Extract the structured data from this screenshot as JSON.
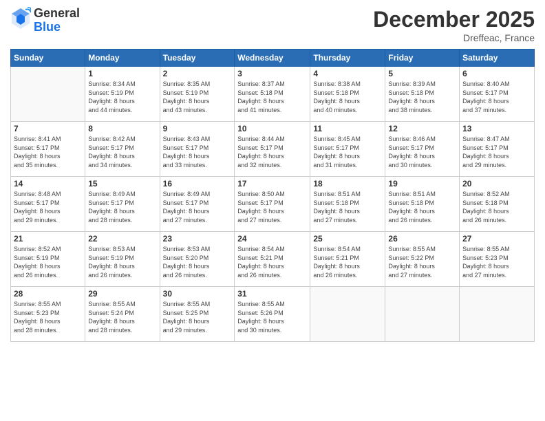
{
  "header": {
    "logo_general": "General",
    "logo_blue": "Blue",
    "month": "December 2025",
    "location": "Dreffeac, France"
  },
  "weekdays": [
    "Sunday",
    "Monday",
    "Tuesday",
    "Wednesday",
    "Thursday",
    "Friday",
    "Saturday"
  ],
  "weeks": [
    [
      {
        "day": "",
        "info": ""
      },
      {
        "day": "1",
        "info": "Sunrise: 8:34 AM\nSunset: 5:19 PM\nDaylight: 8 hours\nand 44 minutes."
      },
      {
        "day": "2",
        "info": "Sunrise: 8:35 AM\nSunset: 5:19 PM\nDaylight: 8 hours\nand 43 minutes."
      },
      {
        "day": "3",
        "info": "Sunrise: 8:37 AM\nSunset: 5:18 PM\nDaylight: 8 hours\nand 41 minutes."
      },
      {
        "day": "4",
        "info": "Sunrise: 8:38 AM\nSunset: 5:18 PM\nDaylight: 8 hours\nand 40 minutes."
      },
      {
        "day": "5",
        "info": "Sunrise: 8:39 AM\nSunset: 5:18 PM\nDaylight: 8 hours\nand 38 minutes."
      },
      {
        "day": "6",
        "info": "Sunrise: 8:40 AM\nSunset: 5:17 PM\nDaylight: 8 hours\nand 37 minutes."
      }
    ],
    [
      {
        "day": "7",
        "info": "Sunrise: 8:41 AM\nSunset: 5:17 PM\nDaylight: 8 hours\nand 35 minutes."
      },
      {
        "day": "8",
        "info": "Sunrise: 8:42 AM\nSunset: 5:17 PM\nDaylight: 8 hours\nand 34 minutes."
      },
      {
        "day": "9",
        "info": "Sunrise: 8:43 AM\nSunset: 5:17 PM\nDaylight: 8 hours\nand 33 minutes."
      },
      {
        "day": "10",
        "info": "Sunrise: 8:44 AM\nSunset: 5:17 PM\nDaylight: 8 hours\nand 32 minutes."
      },
      {
        "day": "11",
        "info": "Sunrise: 8:45 AM\nSunset: 5:17 PM\nDaylight: 8 hours\nand 31 minutes."
      },
      {
        "day": "12",
        "info": "Sunrise: 8:46 AM\nSunset: 5:17 PM\nDaylight: 8 hours\nand 30 minutes."
      },
      {
        "day": "13",
        "info": "Sunrise: 8:47 AM\nSunset: 5:17 PM\nDaylight: 8 hours\nand 29 minutes."
      }
    ],
    [
      {
        "day": "14",
        "info": "Sunrise: 8:48 AM\nSunset: 5:17 PM\nDaylight: 8 hours\nand 29 minutes."
      },
      {
        "day": "15",
        "info": "Sunrise: 8:49 AM\nSunset: 5:17 PM\nDaylight: 8 hours\nand 28 minutes."
      },
      {
        "day": "16",
        "info": "Sunrise: 8:49 AM\nSunset: 5:17 PM\nDaylight: 8 hours\nand 27 minutes."
      },
      {
        "day": "17",
        "info": "Sunrise: 8:50 AM\nSunset: 5:17 PM\nDaylight: 8 hours\nand 27 minutes."
      },
      {
        "day": "18",
        "info": "Sunrise: 8:51 AM\nSunset: 5:18 PM\nDaylight: 8 hours\nand 27 minutes."
      },
      {
        "day": "19",
        "info": "Sunrise: 8:51 AM\nSunset: 5:18 PM\nDaylight: 8 hours\nand 26 minutes."
      },
      {
        "day": "20",
        "info": "Sunrise: 8:52 AM\nSunset: 5:18 PM\nDaylight: 8 hours\nand 26 minutes."
      }
    ],
    [
      {
        "day": "21",
        "info": "Sunrise: 8:52 AM\nSunset: 5:19 PM\nDaylight: 8 hours\nand 26 minutes."
      },
      {
        "day": "22",
        "info": "Sunrise: 8:53 AM\nSunset: 5:19 PM\nDaylight: 8 hours\nand 26 minutes."
      },
      {
        "day": "23",
        "info": "Sunrise: 8:53 AM\nSunset: 5:20 PM\nDaylight: 8 hours\nand 26 minutes."
      },
      {
        "day": "24",
        "info": "Sunrise: 8:54 AM\nSunset: 5:21 PM\nDaylight: 8 hours\nand 26 minutes."
      },
      {
        "day": "25",
        "info": "Sunrise: 8:54 AM\nSunset: 5:21 PM\nDaylight: 8 hours\nand 26 minutes."
      },
      {
        "day": "26",
        "info": "Sunrise: 8:55 AM\nSunset: 5:22 PM\nDaylight: 8 hours\nand 27 minutes."
      },
      {
        "day": "27",
        "info": "Sunrise: 8:55 AM\nSunset: 5:23 PM\nDaylight: 8 hours\nand 27 minutes."
      }
    ],
    [
      {
        "day": "28",
        "info": "Sunrise: 8:55 AM\nSunset: 5:23 PM\nDaylight: 8 hours\nand 28 minutes."
      },
      {
        "day": "29",
        "info": "Sunrise: 8:55 AM\nSunset: 5:24 PM\nDaylight: 8 hours\nand 28 minutes."
      },
      {
        "day": "30",
        "info": "Sunrise: 8:55 AM\nSunset: 5:25 PM\nDaylight: 8 hours\nand 29 minutes."
      },
      {
        "day": "31",
        "info": "Sunrise: 8:55 AM\nSunset: 5:26 PM\nDaylight: 8 hours\nand 30 minutes."
      },
      {
        "day": "",
        "info": ""
      },
      {
        "day": "",
        "info": ""
      },
      {
        "day": "",
        "info": ""
      }
    ]
  ]
}
